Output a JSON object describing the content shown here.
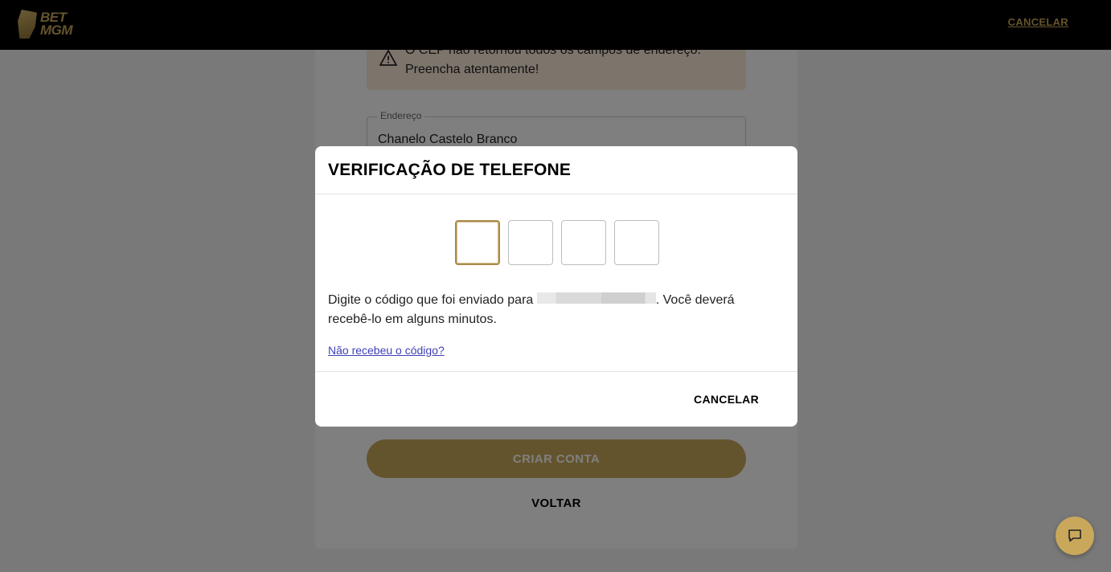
{
  "header": {
    "logo_text_1": "BET",
    "logo_text_2": "MGM",
    "cancel_label": "CANCELAR"
  },
  "background_form": {
    "alert_text": "O CEP não retornou todos os campos de endereço. Preencha atentamente!",
    "address_label": "Endereço",
    "address_value": "Chanelo Castelo Branco",
    "create_account_label": "CRIAR CONTA",
    "back_label": "VOLTAR"
  },
  "modal": {
    "title": "VERIFICAÇÃO DE TELEFONE",
    "code_digits": [
      "",
      "",
      "",
      ""
    ],
    "message_before": "Digite o código que foi enviado para ",
    "message_after": ". Você deverá recebê-lo em alguns minutos.",
    "resend_link": "Não recebeu o código?",
    "cancel_label": "CANCELAR"
  },
  "colors": {
    "brand_gold": "#c9a85b",
    "link_blue": "#3f3fb8"
  },
  "icons": {
    "alert": "warning-triangle-icon",
    "chat": "chat-bubble-icon"
  }
}
